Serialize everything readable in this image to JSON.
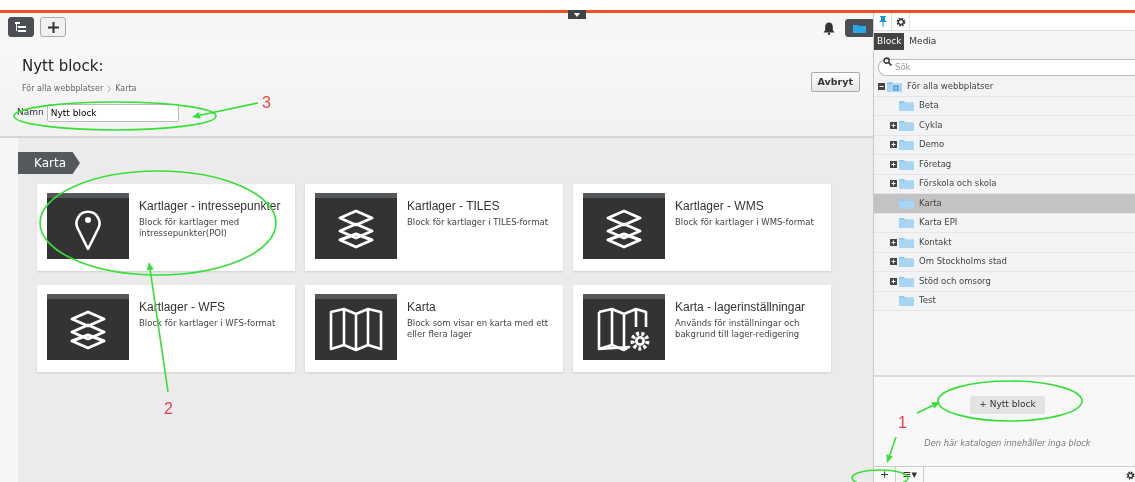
{
  "header": {
    "title": "Nytt block:",
    "breadcrumb": [
      {
        "label": "För alla webbplatser"
      },
      {
        "label": "Karta"
      }
    ],
    "cancel_button": "Avbryt",
    "name_field": {
      "label": "Namn",
      "value": "Nytt block"
    }
  },
  "category": {
    "label": "Karta"
  },
  "blocks": [
    {
      "title": "Kartlager - intressepunkter",
      "description": "Block för kartlager med intressepunkter(POI)",
      "kind": "pin"
    },
    {
      "title": "Kartlager - TILES",
      "description": "Block för kartlager i TILES-format",
      "kind": "layers"
    },
    {
      "title": "Kartlager - WMS",
      "description": "Block för kartlager i WMS-format",
      "kind": "layers"
    },
    {
      "title": "Kartlager - WFS",
      "description": "Block för kartlager i WFS-format",
      "kind": "layers"
    },
    {
      "title": "Karta",
      "description": "Block som visar en karta med ett eller flera lager",
      "kind": "map"
    },
    {
      "title": "Karta - lagerinställningar",
      "description": "Används för inställningar och bakgrund till lager-redigering",
      "kind": "map-gear"
    }
  ],
  "panel": {
    "icon_tabs": [
      {
        "kind": "pin",
        "selected": true
      },
      {
        "kind": "gear",
        "selected": false
      }
    ],
    "tabs": [
      {
        "label": "Block",
        "selected": true
      },
      {
        "label": "Media",
        "selected": false
      }
    ],
    "search": {
      "placeholder": "Sök"
    },
    "tree": [
      {
        "label": "För alla webbplatser",
        "expanded": true,
        "selected": false,
        "children": [
          {
            "label": "Beta",
            "selected": false
          },
          {
            "label": "Cykla",
            "expanded": false,
            "selected": false
          },
          {
            "label": "Demo",
            "expanded": false,
            "selected": false
          },
          {
            "label": "Företag",
            "expanded": false,
            "selected": false
          },
          {
            "label": "Förskola och skola",
            "expanded": false,
            "selected": false
          },
          {
            "label": "Karta",
            "selected": true
          },
          {
            "label": "Karta EPI",
            "selected": false
          },
          {
            "label": "Kontakt",
            "expanded": false,
            "selected": false
          },
          {
            "label": "Om Stockholms stad",
            "expanded": false,
            "selected": false
          },
          {
            "label": "Stöd och omsorg",
            "expanded": false,
            "selected": false
          },
          {
            "label": "Test",
            "selected": false
          }
        ]
      }
    ],
    "new_block_button": "+ Nytt block",
    "empty_message": "Den här katalogen innehåller inga block",
    "bottom_toolbar": [
      {
        "label": "+"
      },
      {
        "label": "≡▾"
      }
    ]
  },
  "annotations": [
    {
      "label": "1"
    },
    {
      "label": "2"
    },
    {
      "label": "3"
    }
  ]
}
